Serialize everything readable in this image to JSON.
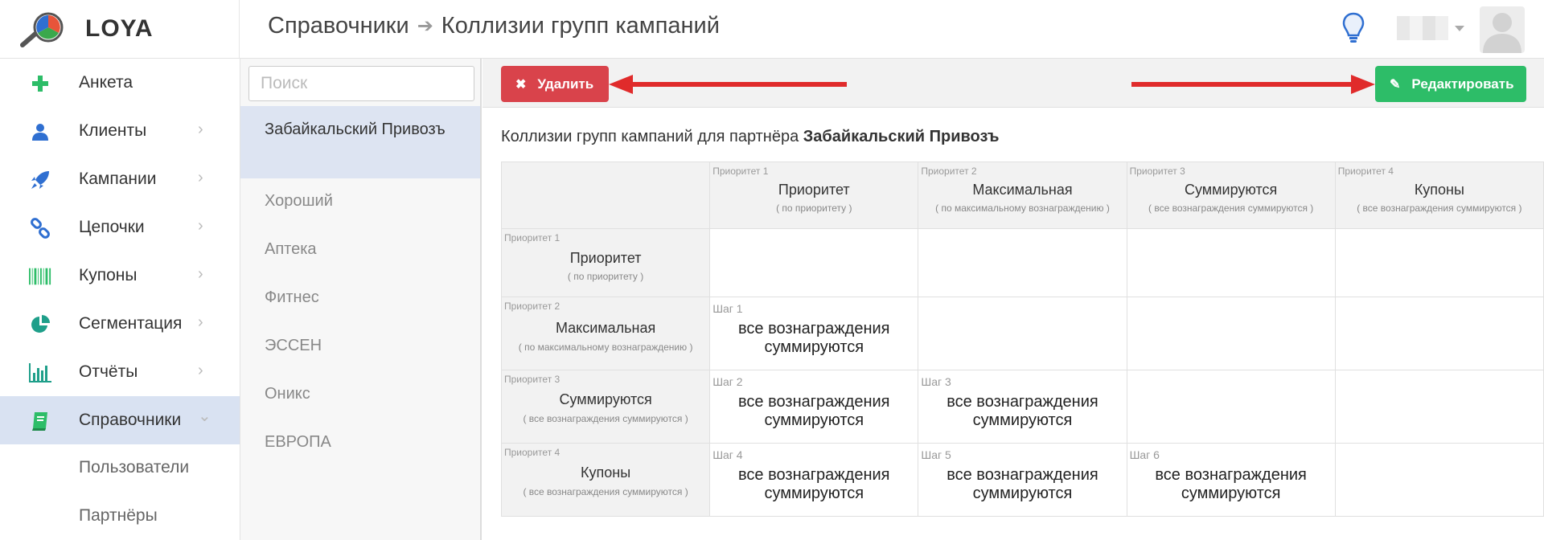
{
  "app": {
    "name": "LOYA"
  },
  "breadcrumb": {
    "section": "Справочники",
    "separator": "➔",
    "page": "Коллизии групп кампаний"
  },
  "sidebar": {
    "items": [
      {
        "label": "Анкета",
        "icon": "plus-icon",
        "chevron": ""
      },
      {
        "label": "Клиенты",
        "icon": "user-icon",
        "chevron": "›"
      },
      {
        "label": "Кампании",
        "icon": "rocket-icon",
        "chevron": "›"
      },
      {
        "label": "Цепочки",
        "icon": "chain-link-icon",
        "chevron": "›"
      },
      {
        "label": "Купоны",
        "icon": "barcode-icon",
        "chevron": "›"
      },
      {
        "label": "Сегментация",
        "icon": "pie-chart-icon",
        "chevron": "›"
      },
      {
        "label": "Отчёты",
        "icon": "bar-chart-icon",
        "chevron": "›"
      },
      {
        "label": "Справочники",
        "icon": "book-icon",
        "chevron": "⌄"
      }
    ],
    "subitems": [
      {
        "label": "Пользователи"
      },
      {
        "label": "Партнёры"
      }
    ]
  },
  "partners": {
    "search_placeholder": "Поиск",
    "items": [
      {
        "label": "Забайкальский Привозъ"
      },
      {
        "label": "Хороший"
      },
      {
        "label": "Аптека"
      },
      {
        "label": "Фитнес"
      },
      {
        "label": "ЭССЕН"
      },
      {
        "label": "Оникс"
      },
      {
        "label": "ЕВРОПА"
      }
    ]
  },
  "toolbar": {
    "delete_label": "Удалить",
    "edit_label": "Редактировать"
  },
  "title": {
    "prefix": "Коллизии групп кампаний для партнёра ",
    "partner": "Забайкальский Привозъ"
  },
  "columns": [
    {
      "priority": "Приоритет 1",
      "name": "Приоритет",
      "desc": "( по приоритету )"
    },
    {
      "priority": "Приоритет 2",
      "name": "Максимальная",
      "desc": "( по максимальному вознаграждению )"
    },
    {
      "priority": "Приоритет 3",
      "name": "Суммируются",
      "desc": "( все вознаграждения суммируются )"
    },
    {
      "priority": "Приоритет 4",
      "name": "Купоны",
      "desc": "( все вознаграждения суммируются )"
    }
  ],
  "rows": [
    {
      "priority": "Приоритет 1",
      "name": "Приоритет",
      "desc": "( по приоритету )",
      "cells": []
    },
    {
      "priority": "Приоритет 2",
      "name": "Максимальная",
      "desc": "( по максимальному вознаграждению )",
      "cells": [
        {
          "step": "Шаг 1",
          "text": "все вознаграждения суммируются"
        }
      ]
    },
    {
      "priority": "Приоритет 3",
      "name": "Суммируются",
      "desc": "( все вознаграждения суммируются )",
      "cells": [
        {
          "step": "Шаг 2",
          "text": "все вознаграждения суммируются"
        },
        {
          "step": "Шаг 3",
          "text": "все вознаграждения суммируются"
        }
      ]
    },
    {
      "priority": "Приоритет 4",
      "name": "Купоны",
      "desc": "( все вознаграждения суммируются )",
      "cells": [
        {
          "step": "Шаг 4",
          "text": "все вознаграждения суммируются"
        },
        {
          "step": "Шаг 5",
          "text": "все вознаграждения суммируются"
        },
        {
          "step": "Шаг 6",
          "text": "все вознаграждения суммируются"
        }
      ]
    }
  ],
  "colors": {
    "accent": "#d9e2f2",
    "delete": "#d9434b",
    "edit": "#2dbd68",
    "arrow": "#e02b2b"
  }
}
